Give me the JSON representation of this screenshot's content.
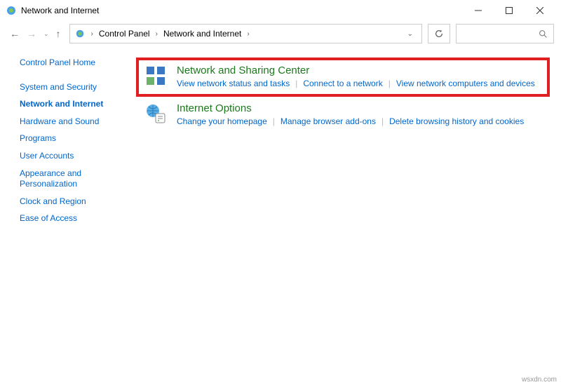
{
  "window": {
    "title": "Network and Internet"
  },
  "breadcrumb": {
    "items": [
      "Control Panel",
      "Network and Internet"
    ]
  },
  "sidebar": {
    "home": "Control Panel Home",
    "items": [
      "System and Security",
      "Network and Internet",
      "Hardware and Sound",
      "Programs",
      "User Accounts",
      "Appearance and Personalization",
      "Clock and Region",
      "Ease of Access"
    ],
    "active_index": 1
  },
  "categories": [
    {
      "title": "Network and Sharing Center",
      "links": [
        "View network status and tasks",
        "Connect to a network",
        "View network computers and devices"
      ],
      "highlighted": true,
      "icon": "network-sharing-icon"
    },
    {
      "title": "Internet Options",
      "links": [
        "Change your homepage",
        "Manage browser add-ons",
        "Delete browsing history and cookies"
      ],
      "highlighted": false,
      "icon": "internet-options-icon"
    }
  ],
  "footer": {
    "credit": "wsxdn.com"
  }
}
